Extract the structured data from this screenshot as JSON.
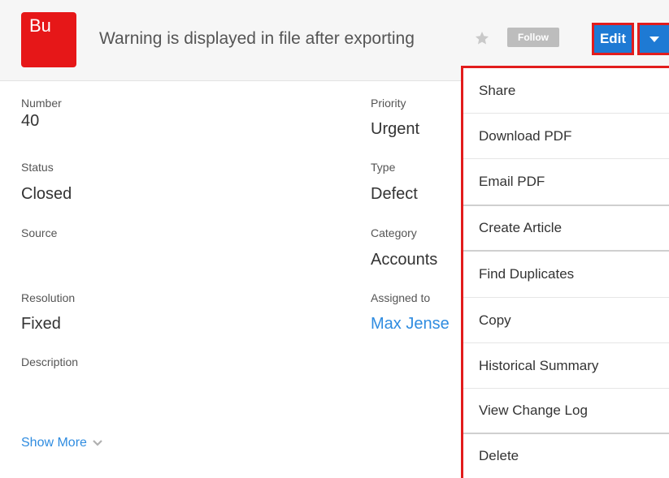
{
  "header": {
    "module_badge": "Bu",
    "title": "Warning is displayed in file after exporting",
    "follow_label": "Follow",
    "edit_label": "Edit"
  },
  "fields": {
    "number": {
      "label": "Number",
      "value": "40"
    },
    "priority": {
      "label": "Priority",
      "value": "Urgent"
    },
    "status": {
      "label": "Status",
      "value": "Closed"
    },
    "type": {
      "label": "Type",
      "value": "Defect"
    },
    "source": {
      "label": "Source",
      "value": ""
    },
    "category": {
      "label": "Category",
      "value": "Accounts"
    },
    "resolution": {
      "label": "Resolution",
      "value": "Fixed"
    },
    "assigned_to": {
      "label": "Assigned to",
      "value": "Max Jense"
    },
    "description": {
      "label": "Description",
      "value": ""
    }
  },
  "show_more": "Show More",
  "menu": {
    "items": [
      {
        "label": "Share"
      },
      {
        "label": "Download PDF"
      },
      {
        "label": "Email PDF"
      },
      {
        "label": "Create Article"
      },
      {
        "label": "Find Duplicates"
      },
      {
        "label": "Copy"
      },
      {
        "label": "Historical Summary"
      },
      {
        "label": "View Change Log"
      },
      {
        "label": "Delete"
      }
    ]
  },
  "colors": {
    "module_badge": "#e61718",
    "primary_button": "#1e7ad4",
    "highlight_border": "#e21c1c",
    "link": "#2f8ce0"
  }
}
